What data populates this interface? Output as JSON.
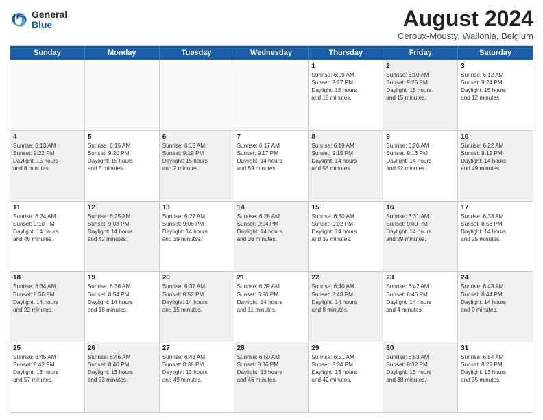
{
  "logo": {
    "general": "General",
    "blue": "Blue"
  },
  "header": {
    "month_year": "August 2024",
    "location": "Ceroux-Mousty, Wallonia, Belgium"
  },
  "days_of_week": [
    "Sunday",
    "Monday",
    "Tuesday",
    "Wednesday",
    "Thursday",
    "Friday",
    "Saturday"
  ],
  "weeks": [
    [
      {
        "day": "",
        "info": "",
        "shaded": false,
        "empty": true
      },
      {
        "day": "",
        "info": "",
        "shaded": false,
        "empty": true
      },
      {
        "day": "",
        "info": "",
        "shaded": false,
        "empty": true
      },
      {
        "day": "",
        "info": "",
        "shaded": false,
        "empty": true
      },
      {
        "day": "1",
        "info": "Sunrise: 6:09 AM\nSunset: 9:27 PM\nDaylight: 15 hours\nand 18 minutes.",
        "shaded": false,
        "empty": false
      },
      {
        "day": "2",
        "info": "Sunrise: 6:10 AM\nSunset: 9:25 PM\nDaylight: 15 hours\nand 15 minutes.",
        "shaded": true,
        "empty": false
      },
      {
        "day": "3",
        "info": "Sunrise: 6:12 AM\nSunset: 9:24 PM\nDaylight: 15 hours\nand 12 minutes.",
        "shaded": false,
        "empty": false
      }
    ],
    [
      {
        "day": "4",
        "info": "Sunrise: 6:13 AM\nSunset: 9:22 PM\nDaylight: 15 hours\nand 8 minutes.",
        "shaded": true,
        "empty": false
      },
      {
        "day": "5",
        "info": "Sunrise: 6:15 AM\nSunset: 9:20 PM\nDaylight: 15 hours\nand 5 minutes.",
        "shaded": false,
        "empty": false
      },
      {
        "day": "6",
        "info": "Sunrise: 6:16 AM\nSunset: 9:19 PM\nDaylight: 15 hours\nand 2 minutes.",
        "shaded": true,
        "empty": false
      },
      {
        "day": "7",
        "info": "Sunrise: 6:17 AM\nSunset: 9:17 PM\nDaylight: 14 hours\nand 59 minutes.",
        "shaded": false,
        "empty": false
      },
      {
        "day": "8",
        "info": "Sunrise: 6:19 AM\nSunset: 9:15 PM\nDaylight: 14 hours\nand 56 minutes.",
        "shaded": true,
        "empty": false
      },
      {
        "day": "9",
        "info": "Sunrise: 6:20 AM\nSunset: 9:13 PM\nDaylight: 14 hours\nand 52 minutes.",
        "shaded": false,
        "empty": false
      },
      {
        "day": "10",
        "info": "Sunrise: 6:22 AM\nSunset: 9:12 PM\nDaylight: 14 hours\nand 49 minutes.",
        "shaded": true,
        "empty": false
      }
    ],
    [
      {
        "day": "11",
        "info": "Sunrise: 6:24 AM\nSunset: 9:10 PM\nDaylight: 14 hours\nand 46 minutes.",
        "shaded": false,
        "empty": false
      },
      {
        "day": "12",
        "info": "Sunrise: 6:25 AM\nSunset: 9:08 PM\nDaylight: 14 hours\nand 42 minutes.",
        "shaded": true,
        "empty": false
      },
      {
        "day": "13",
        "info": "Sunrise: 6:27 AM\nSunset: 9:06 PM\nDaylight: 14 hours\nand 39 minutes.",
        "shaded": false,
        "empty": false
      },
      {
        "day": "14",
        "info": "Sunrise: 6:28 AM\nSunset: 9:04 PM\nDaylight: 14 hours\nand 36 minutes.",
        "shaded": true,
        "empty": false
      },
      {
        "day": "15",
        "info": "Sunrise: 6:30 AM\nSunset: 9:02 PM\nDaylight: 14 hours\nand 32 minutes.",
        "shaded": false,
        "empty": false
      },
      {
        "day": "16",
        "info": "Sunrise: 6:31 AM\nSunset: 9:00 PM\nDaylight: 14 hours\nand 29 minutes.",
        "shaded": true,
        "empty": false
      },
      {
        "day": "17",
        "info": "Sunrise: 6:33 AM\nSunset: 8:58 PM\nDaylight: 14 hours\nand 25 minutes.",
        "shaded": false,
        "empty": false
      }
    ],
    [
      {
        "day": "18",
        "info": "Sunrise: 6:34 AM\nSunset: 8:56 PM\nDaylight: 14 hours\nand 22 minutes.",
        "shaded": true,
        "empty": false
      },
      {
        "day": "19",
        "info": "Sunrise: 6:36 AM\nSunset: 8:54 PM\nDaylight: 14 hours\nand 18 minutes.",
        "shaded": false,
        "empty": false
      },
      {
        "day": "20",
        "info": "Sunrise: 6:37 AM\nSunset: 8:52 PM\nDaylight: 14 hours\nand 15 minutes.",
        "shaded": true,
        "empty": false
      },
      {
        "day": "21",
        "info": "Sunrise: 6:39 AM\nSunset: 8:50 PM\nDaylight: 14 hours\nand 11 minutes.",
        "shaded": false,
        "empty": false
      },
      {
        "day": "22",
        "info": "Sunrise: 6:40 AM\nSunset: 8:48 PM\nDaylight: 14 hours\nand 8 minutes.",
        "shaded": true,
        "empty": false
      },
      {
        "day": "23",
        "info": "Sunrise: 6:42 AM\nSunset: 8:46 PM\nDaylight: 14 hours\nand 4 minutes.",
        "shaded": false,
        "empty": false
      },
      {
        "day": "24",
        "info": "Sunrise: 6:43 AM\nSunset: 8:44 PM\nDaylight: 14 hours\nand 0 minutes.",
        "shaded": true,
        "empty": false
      }
    ],
    [
      {
        "day": "25",
        "info": "Sunrise: 6:45 AM\nSunset: 8:42 PM\nDaylight: 13 hours\nand 57 minutes.",
        "shaded": false,
        "empty": false
      },
      {
        "day": "26",
        "info": "Sunrise: 6:46 AM\nSunset: 8:40 PM\nDaylight: 13 hours\nand 53 minutes.",
        "shaded": true,
        "empty": false
      },
      {
        "day": "27",
        "info": "Sunrise: 6:48 AM\nSunset: 8:38 PM\nDaylight: 13 hours\nand 49 minutes.",
        "shaded": false,
        "empty": false
      },
      {
        "day": "28",
        "info": "Sunrise: 6:50 AM\nSunset: 8:36 PM\nDaylight: 13 hours\nand 46 minutes.",
        "shaded": true,
        "empty": false
      },
      {
        "day": "29",
        "info": "Sunrise: 6:51 AM\nSunset: 8:34 PM\nDaylight: 13 hours\nand 42 minutes.",
        "shaded": false,
        "empty": false
      },
      {
        "day": "30",
        "info": "Sunrise: 6:53 AM\nSunset: 8:32 PM\nDaylight: 13 hours\nand 38 minutes.",
        "shaded": true,
        "empty": false
      },
      {
        "day": "31",
        "info": "Sunrise: 6:54 AM\nSunset: 8:29 PM\nDaylight: 13 hours\nand 35 minutes.",
        "shaded": false,
        "empty": false
      }
    ]
  ]
}
